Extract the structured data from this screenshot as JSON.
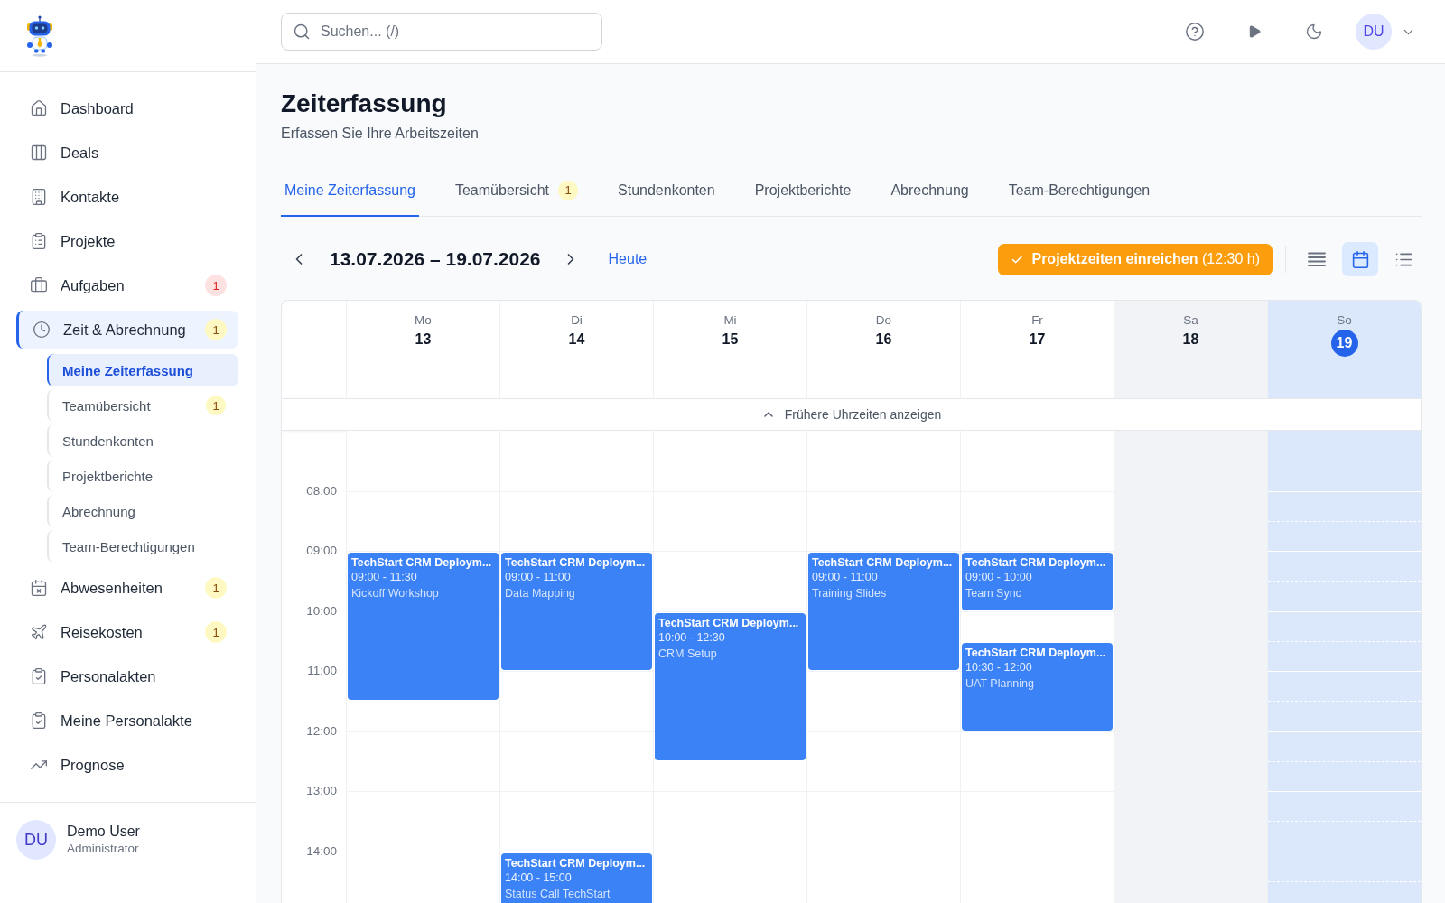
{
  "sidebar": {
    "items": [
      {
        "label": "Dashboard",
        "selected": false
      },
      {
        "label": "Deals",
        "selected": false
      },
      {
        "label": "Kontakte",
        "selected": false
      },
      {
        "label": "Projekte",
        "selected": false
      },
      {
        "label": "Aufgaben",
        "selected": false,
        "badge": {
          "text": "1",
          "kind": "danger"
        }
      },
      {
        "label": "Zeit & Abrechnung",
        "selected": true,
        "badge": {
          "text": "1",
          "kind": "warning"
        },
        "children": [
          {
            "label": "Meine Zeiterfassung",
            "selected": true
          },
          {
            "label": "Teamübersicht",
            "selected": false,
            "badge": {
              "text": "1",
              "kind": "warning"
            }
          },
          {
            "label": "Stundenkonten",
            "selected": false
          },
          {
            "label": "Projektberichte",
            "selected": false
          },
          {
            "label": "Abrechnung",
            "selected": false
          },
          {
            "label": "Team-Berechtigungen",
            "selected": false
          }
        ]
      },
      {
        "label": "Abwesenheiten",
        "selected": false,
        "badge": {
          "text": "1",
          "kind": "warning"
        }
      },
      {
        "label": "Reisekosten",
        "selected": false,
        "badge": {
          "text": "1",
          "kind": "warning"
        }
      },
      {
        "label": "Personalakten",
        "selected": false
      },
      {
        "label": "Meine Personalakte",
        "selected": false
      },
      {
        "label": "Prognose",
        "selected": false
      }
    ],
    "user": {
      "initials": "DU",
      "name": "Demo User",
      "role": "Administrator"
    }
  },
  "header": {
    "search": {
      "placeholder": "Suchen... (/)"
    },
    "avatar": "DU"
  },
  "page": {
    "title": "Zeiterfassung",
    "subtitle": "Erfassen Sie Ihre Arbeitszeiten"
  },
  "tabs": [
    {
      "label": "Meine Zeiterfassung",
      "selected": true
    },
    {
      "label": "Teamübersicht",
      "selected": false,
      "badge": "1"
    },
    {
      "label": "Stundenkonten",
      "selected": false
    },
    {
      "label": "Projektberichte",
      "selected": false
    },
    {
      "label": "Abrechnung",
      "selected": false
    },
    {
      "label": "Team-Berechtigungen",
      "selected": false
    }
  ],
  "toolbar": {
    "date_range": "13.07.2026 – 19.07.2026",
    "today": "Heute",
    "submit": "**Projektzeiten einreichen** (12:30 h)",
    "view_modes": [
      {
        "selected": false
      },
      {
        "selected": true
      },
      {
        "selected": false
      }
    ]
  },
  "calendar": {
    "days": [
      {
        "name": "Mo",
        "date": "13",
        "kind": "weekday",
        "events": [
          {
            "title": "TechStart CRM Deploym...",
            "time": "09:00 - 11:30",
            "description": "Kickoff Workshop"
          }
        ]
      },
      {
        "name": "Di",
        "date": "14",
        "kind": "weekday",
        "events": [
          {
            "title": "TechStart CRM Deploym...",
            "time": "09:00 - 11:00",
            "description": "Data Mapping"
          },
          {
            "title": "TechStart CRM Deploym...",
            "time": "14:00 - 15:00",
            "description": "Status Call TechStart"
          }
        ]
      },
      {
        "name": "Mi",
        "date": "15",
        "kind": "weekday",
        "events": [
          {
            "title": "TechStart CRM Deploym...",
            "time": "10:00 - 12:30",
            "description": "CRM Setup"
          }
        ]
      },
      {
        "name": "Do",
        "date": "16",
        "kind": "weekday",
        "events": [
          {
            "title": "TechStart CRM Deploym...",
            "time": "09:00 - 11:00",
            "description": "Training Slides"
          }
        ]
      },
      {
        "name": "Fr",
        "date": "17",
        "kind": "weekday",
        "events": [
          {
            "title": "TechStart CRM Deploym...",
            "time": "09:00 - 10:00",
            "description": "Team Sync"
          },
          {
            "title": "TechStart CRM Deploym...",
            "time": "10:30 - 12:00",
            "description": "UAT Planning"
          }
        ]
      },
      {
        "name": "Sa",
        "date": "18",
        "kind": "weekend"
      },
      {
        "name": "So",
        "date": "19",
        "kind": "today"
      }
    ],
    "earlier_times": "Frühere Uhrzeiten anzeigen",
    "time_labels": [
      "08:00",
      "09:00",
      "10:00",
      "11:00",
      "12:00",
      "13:00",
      "14:00"
    ]
  }
}
